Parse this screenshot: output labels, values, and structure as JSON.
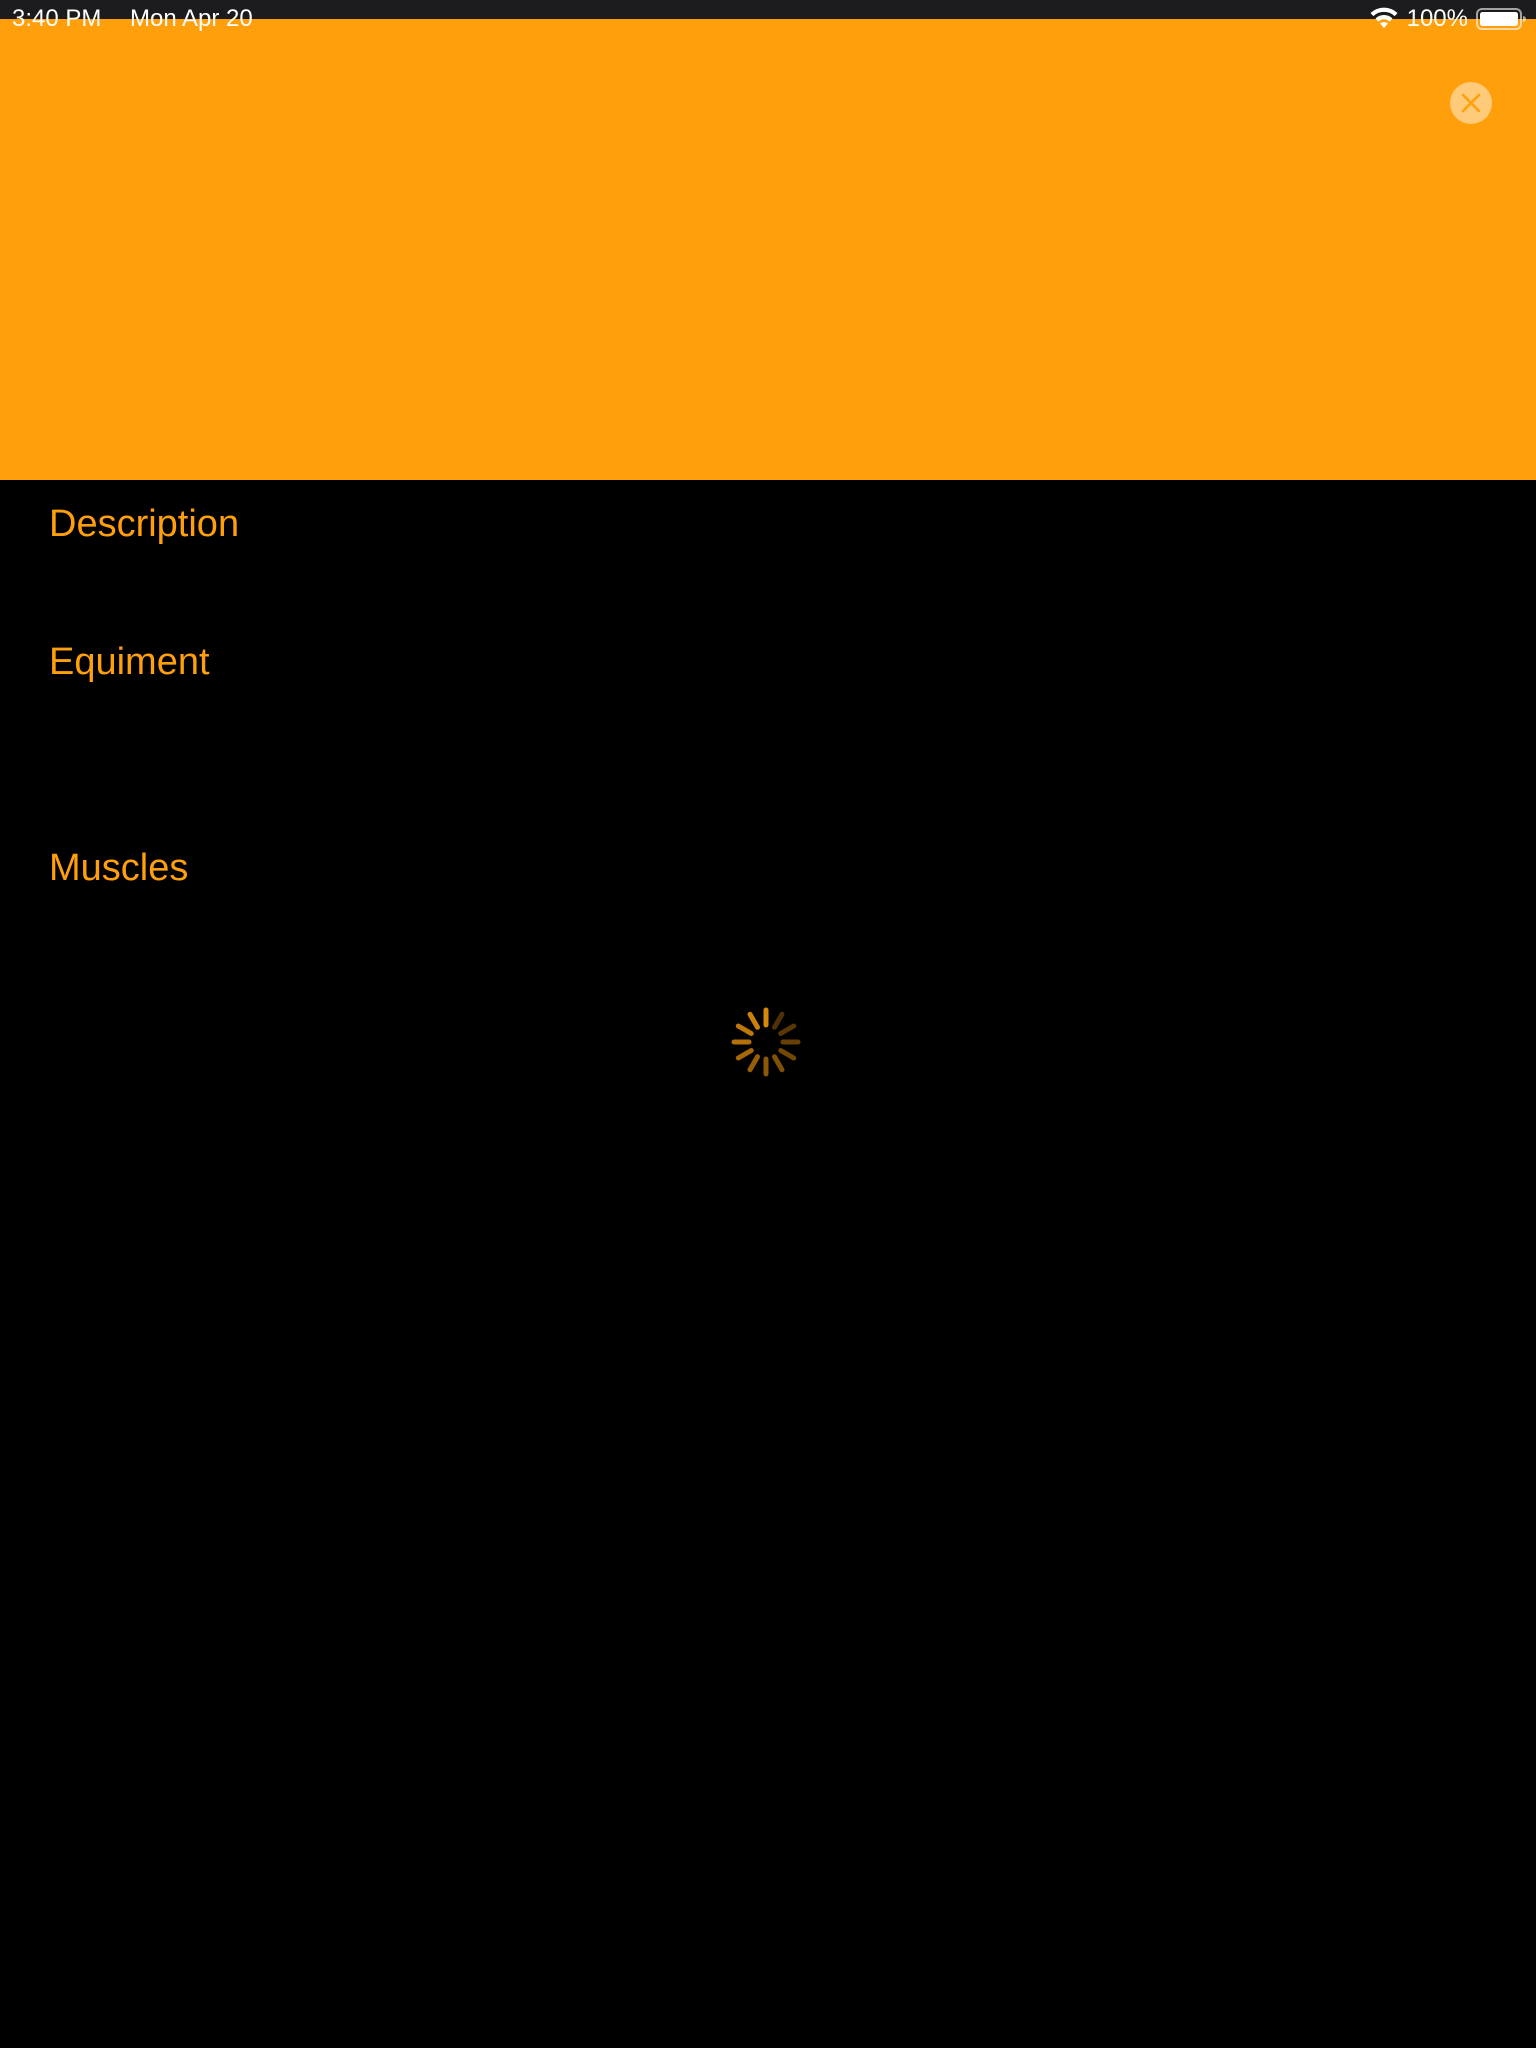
{
  "status_bar": {
    "time": "3:40 PM",
    "date": "Mon Apr 20",
    "battery_percent": "100%",
    "wifi_icon": "wifi-icon",
    "battery_icon": "battery-icon"
  },
  "header": {
    "banner_color": "#ff9f0c",
    "close_icon": "close-icon"
  },
  "sections": {
    "description": "Description",
    "equipment": "Equiment",
    "muscles": "Muscles"
  },
  "loading": {
    "icon": "activity-spinner-icon"
  },
  "colors": {
    "accent": "#ff9f0c",
    "background": "#000000",
    "status_bar": "#1c1c1e"
  }
}
